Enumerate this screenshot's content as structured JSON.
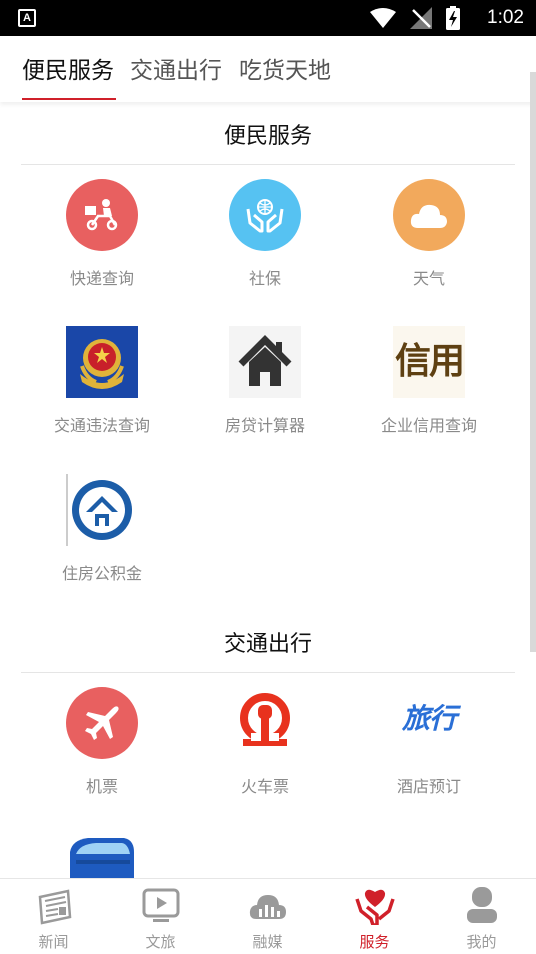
{
  "status_bar": {
    "time": "1:02",
    "left_icon_letter": "A"
  },
  "tabs": [
    {
      "label": "便民服务",
      "active": true
    },
    {
      "label": "交通出行",
      "active": false
    },
    {
      "label": "吃货天地",
      "active": false
    }
  ],
  "sections": [
    {
      "title": "便民服务",
      "items": [
        {
          "label": "快递查询",
          "icon": "courier-scooter-icon",
          "color": "#e86060"
        },
        {
          "label": "社保",
          "icon": "hands-globe-icon",
          "color": "#56c2f2"
        },
        {
          "label": "天气",
          "icon": "cloud-icon",
          "color": "#f2a95c"
        },
        {
          "label": "交通违法查询",
          "icon": "police-badge-icon",
          "color": "#1a47a8"
        },
        {
          "label": "房贷计算器",
          "icon": "house-icon",
          "color": "#333333"
        },
        {
          "label": "企业信用查询",
          "icon": "credit-text-icon",
          "color": "#6b4c1e",
          "icon_text": "信用"
        },
        {
          "label": "住房公积金",
          "icon": "housing-fund-logo-icon",
          "color": "#1c5da8"
        }
      ]
    },
    {
      "title": "交通出行",
      "items": [
        {
          "label": "机票",
          "icon": "airplane-icon",
          "color": "#e86060"
        },
        {
          "label": "火车票",
          "icon": "railway-logo-icon",
          "color": "#e8321e"
        },
        {
          "label": "酒店预订",
          "icon": "travel-text-icon",
          "color": "#2a6fd6",
          "icon_text": "旅行"
        },
        {
          "label": "",
          "icon": "bus-icon",
          "color": "#1e5bc0"
        }
      ]
    }
  ],
  "bottom_nav": [
    {
      "label": "新闻",
      "icon": "newspaper-icon",
      "active": false
    },
    {
      "label": "文旅",
      "icon": "video-play-icon",
      "active": false
    },
    {
      "label": "融媒",
      "icon": "cloud-chart-icon",
      "active": false
    },
    {
      "label": "服务",
      "icon": "heart-hands-icon",
      "active": true
    },
    {
      "label": "我的",
      "icon": "user-icon",
      "active": false
    }
  ],
  "colors": {
    "accent": "#d0202a",
    "label_gray": "#8a8a8a",
    "inactive_nav": "#9a9a9a"
  }
}
